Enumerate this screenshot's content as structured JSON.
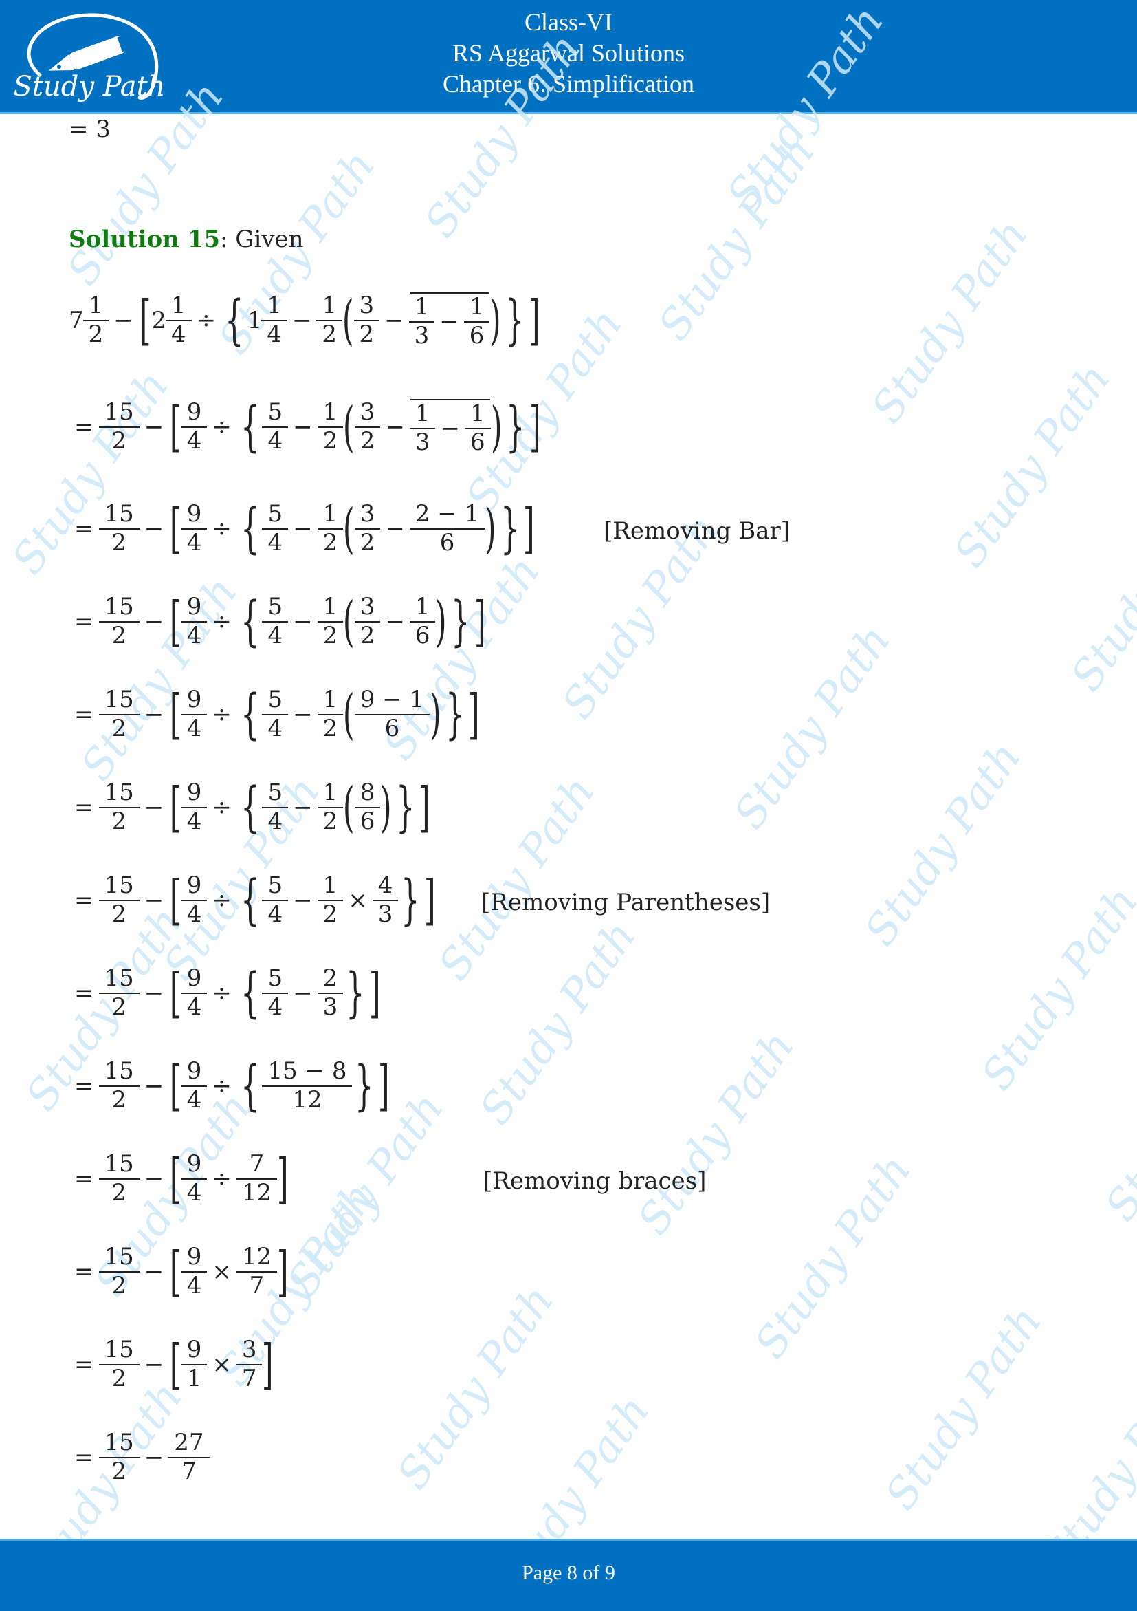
{
  "header": {
    "logo_text": "Study Path",
    "line1": "Class-VI",
    "line2": "RS Aggarwal Solutions",
    "line3": "Chapter 6: Simplification"
  },
  "watermark_text": "Study Path",
  "previous_result": "= 3",
  "solution": {
    "label": "Solution 15",
    "suffix": ": Given"
  },
  "steps": [
    {
      "expr": "7 1/2 − [2 1/4 ÷ {1 1/4 − 1/2(3/2 − ‾(1/3 − 1/6))}]",
      "note": ""
    },
    {
      "expr": "= 15/2 − [9/4 ÷ {5/4 − 1/2(3/2 − ‾(1/3 − 1/6))}]",
      "note": ""
    },
    {
      "expr": "= 15/2 − [9/4 ÷ {5/4 − 1/2(3/2 − (2 − 1)/6)}]",
      "note": "[Removing Bar]"
    },
    {
      "expr": "= 15/2 − [9/4 ÷ {5/4 − 1/2(3/2 − 1/6)}]",
      "note": ""
    },
    {
      "expr": "= 15/2 − [9/4 ÷ {5/4 − 1/2((9 − 1)/6)}]",
      "note": ""
    },
    {
      "expr": "= 15/2 − [9/4 ÷ {5/4 − 1/2(8/6)}]",
      "note": ""
    },
    {
      "expr": "= 15/2 − [9/4 ÷ {5/4 − 1/2 × 4/3}]",
      "note": "[Removing Parentheses]"
    },
    {
      "expr": "= 15/2 − [9/4 ÷ {5/4 − 2/3}]",
      "note": ""
    },
    {
      "expr": "= 15/2 − [9/4 ÷ {(15 − 8)/12}]",
      "note": ""
    },
    {
      "expr": "= 15/2 − [9/4 ÷ 7/12]",
      "note": "[Removing braces]"
    },
    {
      "expr": "= 15/2 − [9/4 × 12/7]",
      "note": ""
    },
    {
      "expr": "= 15/2 − [9/1 × 3/7]",
      "note": ""
    },
    {
      "expr": "= 15/2 − 27/7",
      "note": ""
    }
  ],
  "t": {
    "eq": "=",
    "minus": "−",
    "div": "÷",
    "times": "×",
    "lb": "[",
    "rb": "]",
    "lc": "{",
    "rc": "}",
    "lp": "(",
    "rp": ")",
    "n1": "1",
    "n2": "2",
    "n3": "3",
    "n4": "4",
    "n5": "5",
    "n6": "6",
    "n7": "7",
    "n8": "8",
    "n9": "9",
    "n12": "12",
    "n15": "15",
    "n27": "27",
    "e2m1": "2 − 1",
    "e9m1": "9 − 1",
    "e15m8": "15 − 8"
  },
  "footer": {
    "page_label": "Page 8 of 9"
  }
}
